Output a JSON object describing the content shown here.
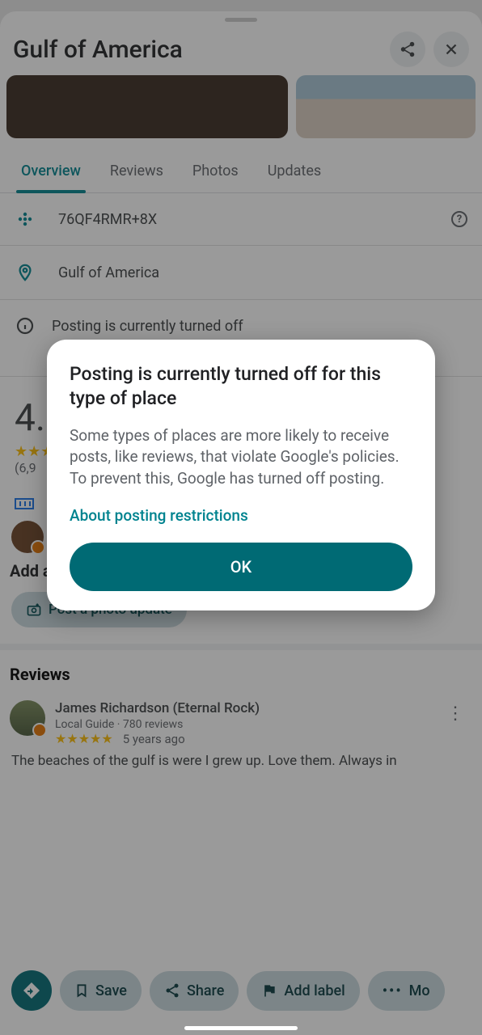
{
  "header": {
    "title": "Gulf of America"
  },
  "tabs": [
    "Overview",
    "Reviews",
    "Photos",
    "Updates"
  ],
  "info": {
    "plus_code": "76QF4RMR+8X",
    "location": "Gulf of America",
    "posting_note": "Posting is currently turned off"
  },
  "rating": {
    "score": "4.",
    "stars": "★★★",
    "count": "(6,9"
  },
  "highlight": {
    "heading": "Add a highlight from a recent visit",
    "cta": "Post a photo update"
  },
  "reviews": {
    "heading": "Reviews",
    "items": [
      {
        "name": "James Richardson (Eternal Rock)",
        "meta": "Local Guide · 780 reviews",
        "stars": "★★★★★",
        "time": "5 years ago",
        "text": "The beaches of the gulf is were I grew up. Love them. Always in"
      }
    ]
  },
  "bottom": {
    "save": "Save",
    "share": "Share",
    "add_label": "Add label",
    "more": "Mo"
  },
  "dialog": {
    "title": "Posting is currently turned off for this type of place",
    "body": "Some types of places are more likely to receive posts, like reviews, that violate Google's policies. To prevent this, Google has turned off posting.",
    "link": "About posting restrictions",
    "ok": "OK"
  }
}
